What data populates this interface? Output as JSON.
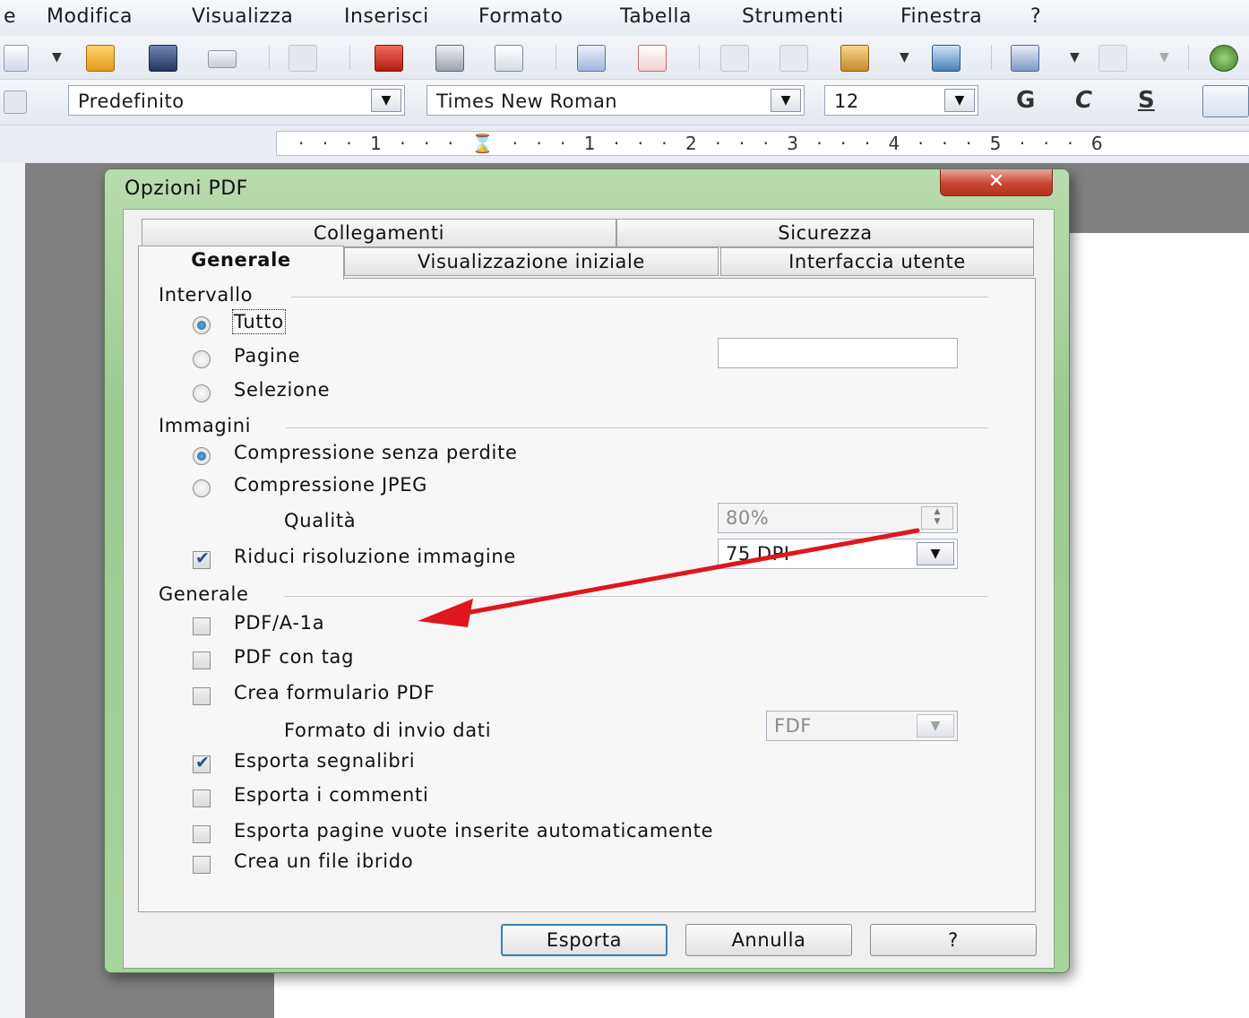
{
  "menu": {
    "items": [
      {
        "label": "e"
      },
      {
        "label": "Modifica"
      },
      {
        "label": "Visualizza"
      },
      {
        "label": "Inserisci"
      },
      {
        "label": "Formato"
      },
      {
        "label": "Tabella"
      },
      {
        "label": "Strumenti"
      },
      {
        "label": "Finestra"
      },
      {
        "label": "?"
      }
    ]
  },
  "formatbar": {
    "style": "Predefinito",
    "font": "Times New Roman",
    "size": "12",
    "bold": "G",
    "italic": "C",
    "underline": "S"
  },
  "ruler": {
    "text": "·  ·  ·  1  ·  ·  ·  ⌛  ·  ·  ·  1  ·  ·  ·  2  ·  ·  ·  3  ·  ·  ·  4  ·  ·  ·  5  ·  ·  ·  6"
  },
  "dialog": {
    "title": "Opzioni PDF",
    "close": "✕",
    "tabs": {
      "collegamenti": "Collegamenti",
      "sicurezza": "Sicurezza",
      "generale": "Generale",
      "visualizzazione": "Visualizzazione iniziale",
      "interfaccia": "Interfaccia utente"
    },
    "intervallo": {
      "label": "Intervallo",
      "tutto": "Tutto",
      "pagine": "Pagine",
      "pagine_value": "",
      "selezione": "Selezione",
      "selected": "tutto"
    },
    "immagini": {
      "label": "Immagini",
      "lossless": "Compressione senza perdite",
      "jpeg": "Compressione JPEG",
      "qualita_label": "Qualità",
      "qualita_value": "80%",
      "riduci_label": "Riduci risoluzione immagine",
      "riduci_checked": true,
      "dpi_value": "75 DPI",
      "selected": "lossless"
    },
    "generale": {
      "label": "Generale",
      "pdfa": "PDF/A-1a",
      "pdf_tag": "PDF con tag",
      "crea_form": "Crea formulario PDF",
      "formato_label": "Formato di invio dati",
      "formato_value": "FDF",
      "segnalibri": "Esporta segnalibri",
      "segnalibri_checked": true,
      "commenti": "Esporta i commenti",
      "pagine_vuote": "Esporta pagine vuote inserite automaticamente",
      "ibrido": "Crea un file ibrido"
    },
    "buttons": {
      "esporta": "Esporta",
      "annulla": "Annulla",
      "help": "?"
    }
  },
  "annotation": {
    "arrow_color": "#e0161d"
  },
  "colors": {
    "dialog_frame": "#a7d39c",
    "close_button": "#c9452f"
  }
}
